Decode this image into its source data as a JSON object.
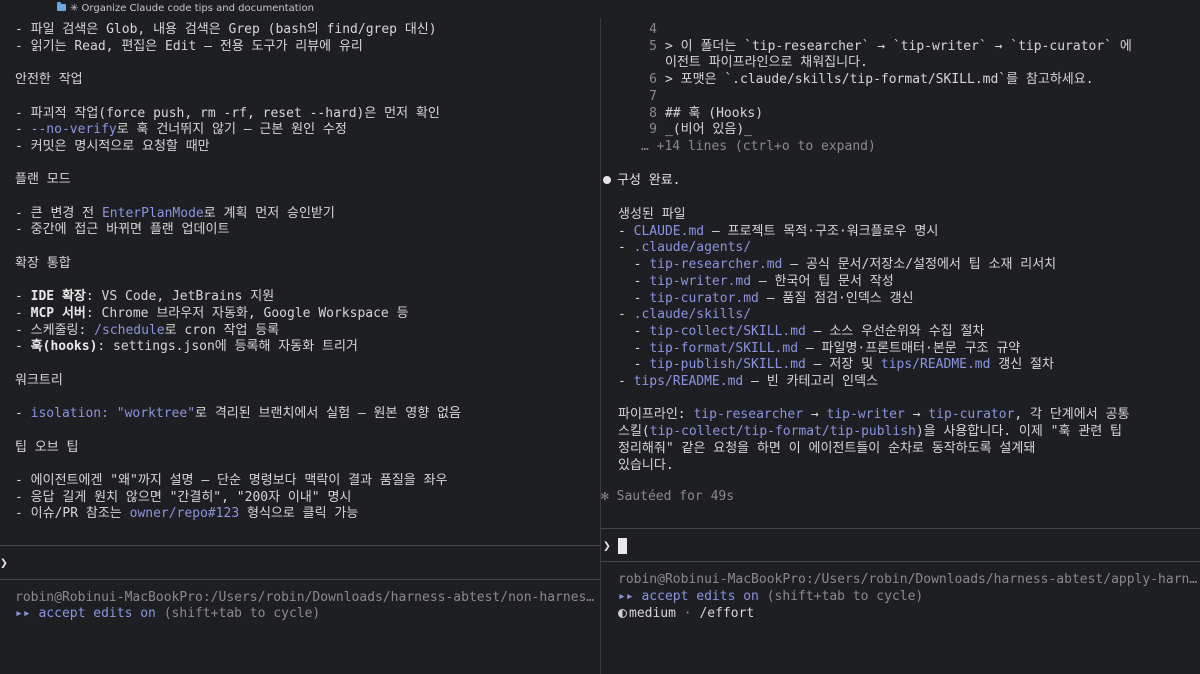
{
  "window": {
    "title": "✳ Organize Claude code tips and documentation"
  },
  "left": {
    "lines": [
      [
        {
          "t": "- 파일 검색은 Glob, 내용 검색은 Grep (bash의 find/grep 대신)"
        }
      ],
      [
        {
          "t": "- 읽기는 Read, 편집은 Edit — 전용 도구가 리뷰에 유리"
        }
      ],
      [],
      [
        {
          "t": "안전한 작업"
        }
      ],
      [],
      [
        {
          "t": "- 파괴적 작업(force push, rm -rf, reset --hard)은 먼저 확인"
        }
      ],
      [
        {
          "t": "- "
        },
        {
          "t": "--no-verify",
          "c": "accent"
        },
        {
          "t": "로 훅 건너뛰지 않기 — 근본 원인 수정"
        }
      ],
      [
        {
          "t": "- 커밋은 명시적으로 요청할 때만"
        }
      ],
      [],
      [
        {
          "t": "플랜 모드"
        }
      ],
      [],
      [
        {
          "t": "- 큰 변경 전 "
        },
        {
          "t": "EnterPlanMode",
          "c": "accent"
        },
        {
          "t": "로 계획 먼저 승인받기"
        }
      ],
      [
        {
          "t": "- 중간에 접근 바뀌면 플랜 업데이트"
        }
      ],
      [],
      [
        {
          "t": "확장 통합"
        }
      ],
      [],
      [
        {
          "t": "- "
        },
        {
          "t": "IDE 확장",
          "c": "bold"
        },
        {
          "t": ": VS Code, JetBrains 지원"
        }
      ],
      [
        {
          "t": "- "
        },
        {
          "t": "MCP 서버",
          "c": "bold"
        },
        {
          "t": ": Chrome 브라우저 자동화, Google Workspace 등"
        }
      ],
      [
        {
          "t": "- 스케줄링: "
        },
        {
          "t": "/schedule",
          "c": "accent"
        },
        {
          "t": "로 cron 작업 등록"
        }
      ],
      [
        {
          "t": "- "
        },
        {
          "t": "훅(hooks)",
          "c": "bold"
        },
        {
          "t": ": settings.json에 등록해 자동화 트리거"
        }
      ],
      [],
      [
        {
          "t": "워크트리"
        }
      ],
      [],
      [
        {
          "t": "- "
        },
        {
          "t": "isolation: \"worktree\"",
          "c": "accent"
        },
        {
          "t": "로 격리된 브랜치에서 실험 — 원본 영향 없음"
        }
      ],
      [],
      [
        {
          "t": "팁 오브 팁"
        }
      ],
      [],
      [
        {
          "t": "- 에이전트에겐 \"왜\"까지 설명 — 단순 명령보다 맥락이 결과 품질을 좌우"
        }
      ],
      [
        {
          "t": "- 응답 길게 원치 않으면 \"간결히\", \"200자 이내\" 명시"
        }
      ],
      [
        {
          "t": "- 이슈/PR 참조는 "
        },
        {
          "t": "owner/repo#123",
          "c": "accent"
        },
        {
          "t": " 형식으로 클릭 가능"
        }
      ]
    ],
    "prompt_symbol": "❯",
    "status_path": "robin@Robinui-MacBookPro:/Users/robin/Downloads/harness-abtest/non-harnes…",
    "accept_edits": {
      "arrows": "▸▸",
      "label": "accept edits on",
      "hint": "(shift+tab to cycle)"
    }
  },
  "right": {
    "file_lines": [
      {
        "n": "4",
        "t": ""
      },
      {
        "n": "5",
        "t": "> 이 폴더는 `tip-researcher` → `tip-writer` → `tip-curator` 에"
      },
      {
        "n": "",
        "t": "이전트 파이프라인으로 채워집니다."
      },
      {
        "n": "6",
        "t": "> 포맷은 `.claude/skills/tip-format/SKILL.md`를 참고하세요."
      },
      {
        "n": "7",
        "t": ""
      },
      {
        "n": "8",
        "t": "## 훅 (Hooks)"
      },
      {
        "n": "9",
        "t": "_(비어 있음)_"
      }
    ],
    "expand_hint": "… +14 lines (ctrl+o to expand)",
    "done_message": "구성 완료.",
    "body_lines": [
      [
        {
          "t": "생성된 파일"
        }
      ],
      [
        {
          "t": "- "
        },
        {
          "t": "CLAUDE.md",
          "c": "accent"
        },
        {
          "t": " — 프로젝트 목적·구조·워크플로우 명시"
        }
      ],
      [
        {
          "t": "- "
        },
        {
          "t": ".claude/agents/",
          "c": "accent"
        }
      ],
      [
        {
          "t": "  - "
        },
        {
          "t": "tip-researcher.md",
          "c": "accent"
        },
        {
          "t": " — 공식 문서/저장소/설정에서 팁 소재 리서치"
        }
      ],
      [
        {
          "t": "  - "
        },
        {
          "t": "tip-writer.md",
          "c": "accent"
        },
        {
          "t": " — 한국어 팁 문서 작성"
        }
      ],
      [
        {
          "t": "  - "
        },
        {
          "t": "tip-curator.md",
          "c": "accent"
        },
        {
          "t": " — 품질 점검·인덱스 갱신"
        }
      ],
      [
        {
          "t": "- "
        },
        {
          "t": ".claude/skills/",
          "c": "accent"
        }
      ],
      [
        {
          "t": "  - "
        },
        {
          "t": "tip-collect/SKILL.md",
          "c": "accent"
        },
        {
          "t": " — 소스 우선순위와 수집 절차"
        }
      ],
      [
        {
          "t": "  - "
        },
        {
          "t": "tip-format/SKILL.md",
          "c": "accent"
        },
        {
          "t": " — 파일명·프론트매터·본문 구조 규약"
        }
      ],
      [
        {
          "t": "  - "
        },
        {
          "t": "tip-publish/SKILL.md",
          "c": "accent"
        },
        {
          "t": " — 저장 및 "
        },
        {
          "t": "tips/README.md",
          "c": "accent"
        },
        {
          "t": " 갱신 절차"
        }
      ],
      [
        {
          "t": "- "
        },
        {
          "t": "tips/README.md",
          "c": "accent"
        },
        {
          "t": " — 빈 카테고리 인덱스"
        }
      ],
      [],
      [
        {
          "t": "파이프라인: "
        },
        {
          "t": "tip-researcher",
          "c": "accent"
        },
        {
          "t": " → "
        },
        {
          "t": "tip-writer",
          "c": "accent"
        },
        {
          "t": " → "
        },
        {
          "t": "tip-curator",
          "c": "accent"
        },
        {
          "t": ", 각 단계에서 공통"
        }
      ],
      [
        {
          "t": "스킬("
        },
        {
          "t": "tip-collect/tip-format/tip-publish",
          "c": "accent"
        },
        {
          "t": ")을 사용합니다. 이제 \"훅 관련 팁"
        }
      ],
      [
        {
          "t": "정리해줘\" 같은 요청을 하면 이 에이전트들이 순차로 동작하도록 설계돼"
        }
      ],
      [
        {
          "t": "있습니다."
        }
      ]
    ],
    "timer": "✻ Sautéed for 49s",
    "prompt_symbol": "❯",
    "status_path": "robin@Robinui-MacBookPro:/Users/robin/Downloads/harness-abtest/apply-harn…",
    "accept_edits": {
      "arrows": "▸▸",
      "label": "accept edits on",
      "hint": "(shift+tab to cycle)"
    },
    "effort": {
      "level": "medium",
      "sep": "·",
      "command": "/effort"
    }
  },
  "colors": {
    "bg": "#1e1f22",
    "accent": "#8c93e0",
    "muted": "#8a8a8a",
    "text": "#d6d6d6"
  }
}
